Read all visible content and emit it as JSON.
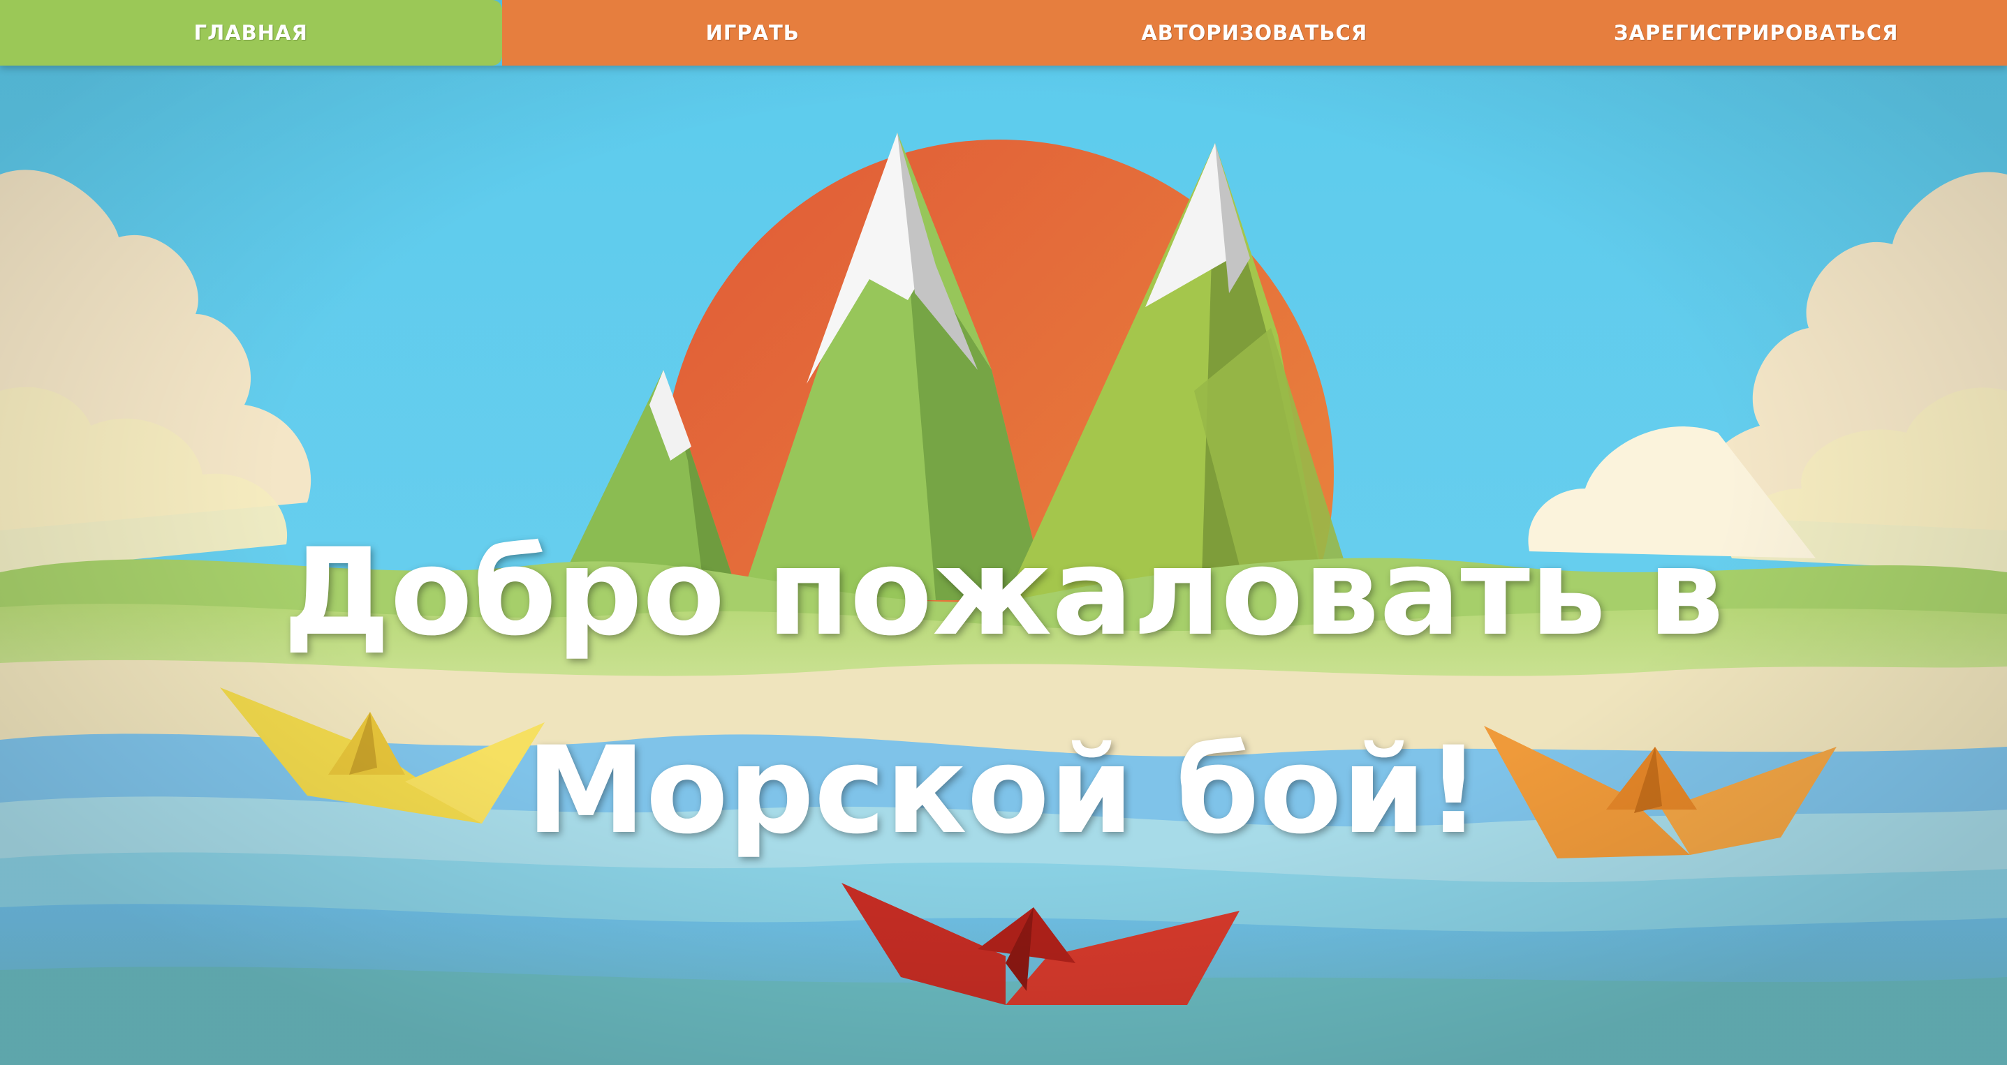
{
  "nav": {
    "items": [
      {
        "label": "ГЛАВНАЯ",
        "active": true
      },
      {
        "label": "ИГРАТЬ",
        "active": false
      },
      {
        "label": "АВТОРИЗОВАТЬСЯ",
        "active": false
      },
      {
        "label": "ЗАРЕГИСТРИРОВАТЬСЯ",
        "active": false
      }
    ]
  },
  "hero": {
    "title_line1": "Добро пожаловать в",
    "title_line2": "Морской бой!"
  },
  "colors": {
    "nav_orange": "#e67e3e",
    "nav_green_active": "#9bc857",
    "sky": "#5ac8ec",
    "sun": "#e5683a"
  },
  "illustration": {
    "icons": [
      "cloud-icon",
      "sun-icon",
      "mountain-icon",
      "paper-boat-icon",
      "sea-wave-icon"
    ]
  }
}
